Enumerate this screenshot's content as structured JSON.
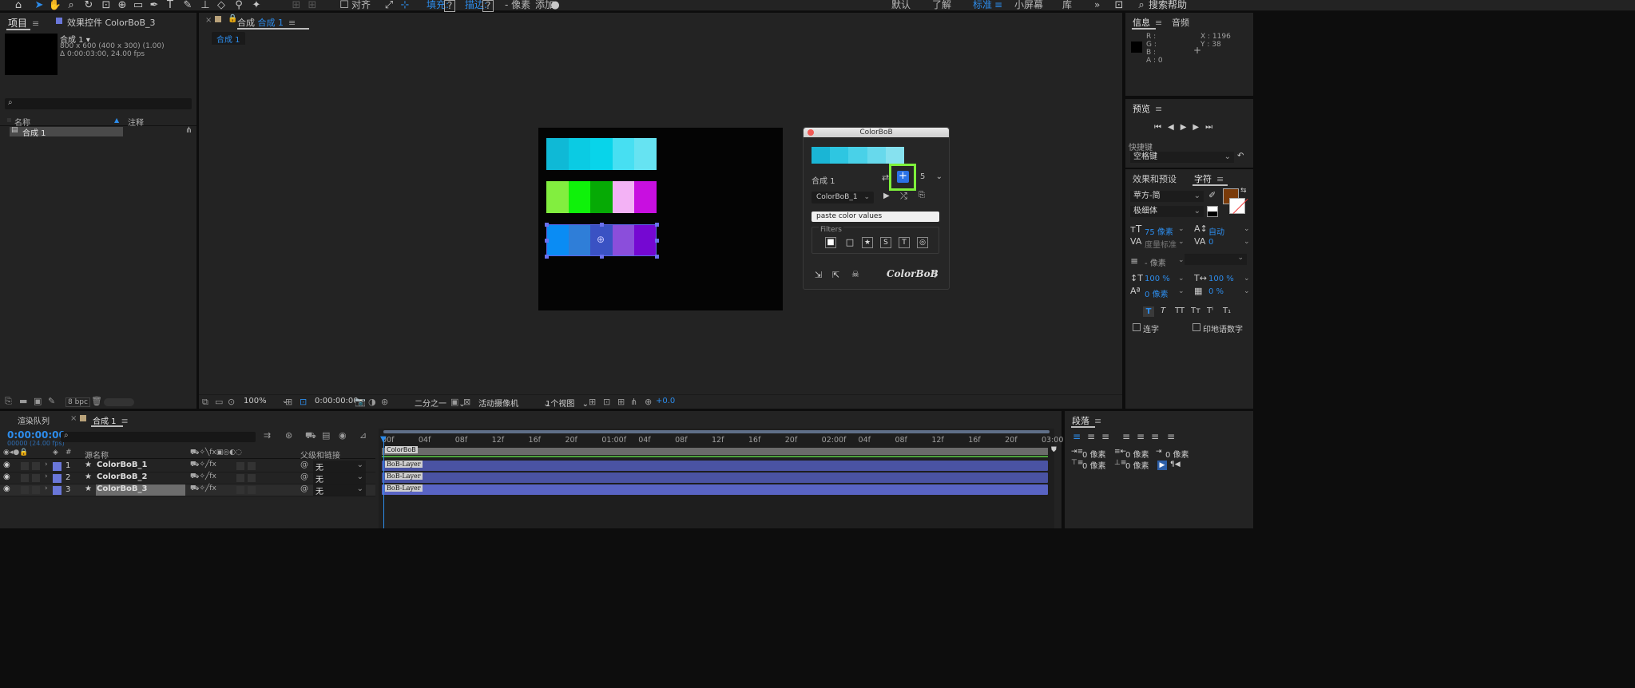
{
  "toolbar": {
    "align_label": "对齐",
    "fill_label": "填充:",
    "fill_value": "?",
    "stroke_label": "描边:",
    "stroke_value": "?",
    "stroke_px": "- 像素",
    "add_label": "添加:",
    "workspaces": [
      "默认",
      "了解",
      "标准",
      "小屏幕",
      "库"
    ],
    "active_workspace": "标准",
    "search_help": "搜索帮助"
  },
  "project_panel": {
    "tab_project": "项目",
    "tab_effects": "效果控件 ColorBoB_3",
    "comp_name": "合成 1 ▾",
    "comp_size": "800 x 600  (400 x 300) (1.00)",
    "comp_duration": "Δ 0:00:03:00, 24.00 fps",
    "col_name": "名称",
    "col_comment": "注释",
    "items": [
      "合成 1"
    ],
    "bpc": "8 bpc"
  },
  "comp_viewer": {
    "tab_label": "合成",
    "tab_comp": "合成 1",
    "breadcrumb": "合成 1",
    "zoom": "100%",
    "timecode": "0:00:00:00",
    "resolution": "二分之一",
    "camera": "活动摄像机",
    "views": "1个视图",
    "exposure": "+0.0"
  },
  "colorbob": {
    "title": "ColorBoB",
    "comp_label": "合成 1",
    "count": "5",
    "layer_select": "ColorBoB_1",
    "paste_placeholder": "paste color values",
    "filters_label": "Filters",
    "logo": "ColorBoB",
    "help": "?",
    "preview_colors": [
      "#1ab5d5",
      "#2ec6e1",
      "#49d1e8",
      "#67d9ec",
      "#86e1ef"
    ]
  },
  "canvas_rows": [
    [
      "#0fb9d6",
      "#0bcbe3",
      "#08d4ea",
      "#47dff2",
      "#66e3f2"
    ],
    [
      "#82ee3f",
      "#0ff20a",
      "#06aa05",
      "#f3b2f5",
      "#c80fe0"
    ],
    [
      "#0a8cf4",
      "#2f7ed8",
      "#3a52c3",
      "#8b4edb",
      "#7508d2"
    ]
  ],
  "info_panel": {
    "tab_info": "信息",
    "tab_audio": "音频",
    "r": "R :",
    "g": "G :",
    "b": "B :",
    "a": "A : 0",
    "x": "X : 1196",
    "y": "Y : 38"
  },
  "preview_panel": {
    "title": "预览",
    "shortcut_label": "快捷键",
    "shortcut_value": "空格键"
  },
  "character_panel": {
    "tab_effects": "效果和预设",
    "tab_char": "字符",
    "font": "苹方-简",
    "style": "极细体",
    "size": "75 像素",
    "leading": "自动",
    "kerning": "度量标准",
    "tracking": "0",
    "stroke": "- 像素",
    "vscale": "100 %",
    "hscale": "100 %",
    "baseline": "0 像素",
    "tsume": "0 %",
    "ligature": "连字",
    "hindi": "印地语数字",
    "fill_color": "#7a3b0a"
  },
  "timeline": {
    "tab_render": "渲染队列",
    "tab_comp": "合成 1",
    "timecode": "0:00:00:00",
    "frames": "00000 (24.00 fps)",
    "col_source": "源名称",
    "col_parent": "父级和链接",
    "ruler": [
      "00f",
      "04f",
      "08f",
      "12f",
      "16f",
      "20f",
      "01:00f",
      "04f",
      "08f",
      "12f",
      "16f",
      "20f",
      "02:00f",
      "04f",
      "08f",
      "12f",
      "16f",
      "20f",
      "03:00"
    ],
    "bar_label_top": "ColorBoB",
    "layers": [
      {
        "num": "1",
        "name": "ColorBoB_1",
        "parent": "无",
        "bar": "BoB-Layer"
      },
      {
        "num": "2",
        "name": "ColorBoB_2",
        "parent": "无",
        "bar": "BoB-Layer"
      },
      {
        "num": "3",
        "name": "ColorBoB_3",
        "parent": "无",
        "bar": "BoB-Layer"
      }
    ]
  },
  "paragraph_panel": {
    "title": "段落",
    "v1": "0 像素",
    "v2": "0 像素",
    "v3": "0 像素",
    "v4": "0 像素",
    "v5": "0 像素"
  }
}
